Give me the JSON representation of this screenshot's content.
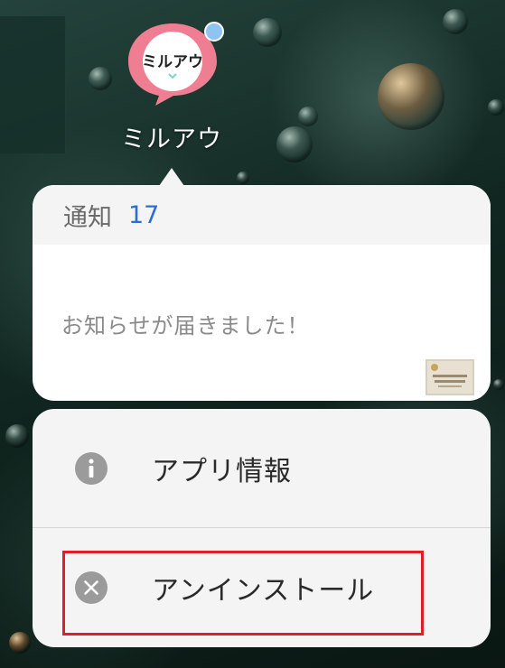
{
  "app": {
    "name": "ミルアウ",
    "logo_text": "ミルアウ",
    "icon": "milau-app-icon",
    "badge_color": "#8fc3f2",
    "logo_bg_color": "#f07e93"
  },
  "notification": {
    "title": "通知",
    "count": "17",
    "message": "お知らせが届きました！",
    "thumbnail_icon": "notification-thumbnail"
  },
  "actions": [
    {
      "label": "アプリ情報",
      "icon": "info-icon"
    },
    {
      "label": "アンインストール",
      "icon": "close-circle-icon"
    }
  ],
  "colors": {
    "accent_blue": "#2c6fd1",
    "highlight_red": "#e01e25"
  }
}
